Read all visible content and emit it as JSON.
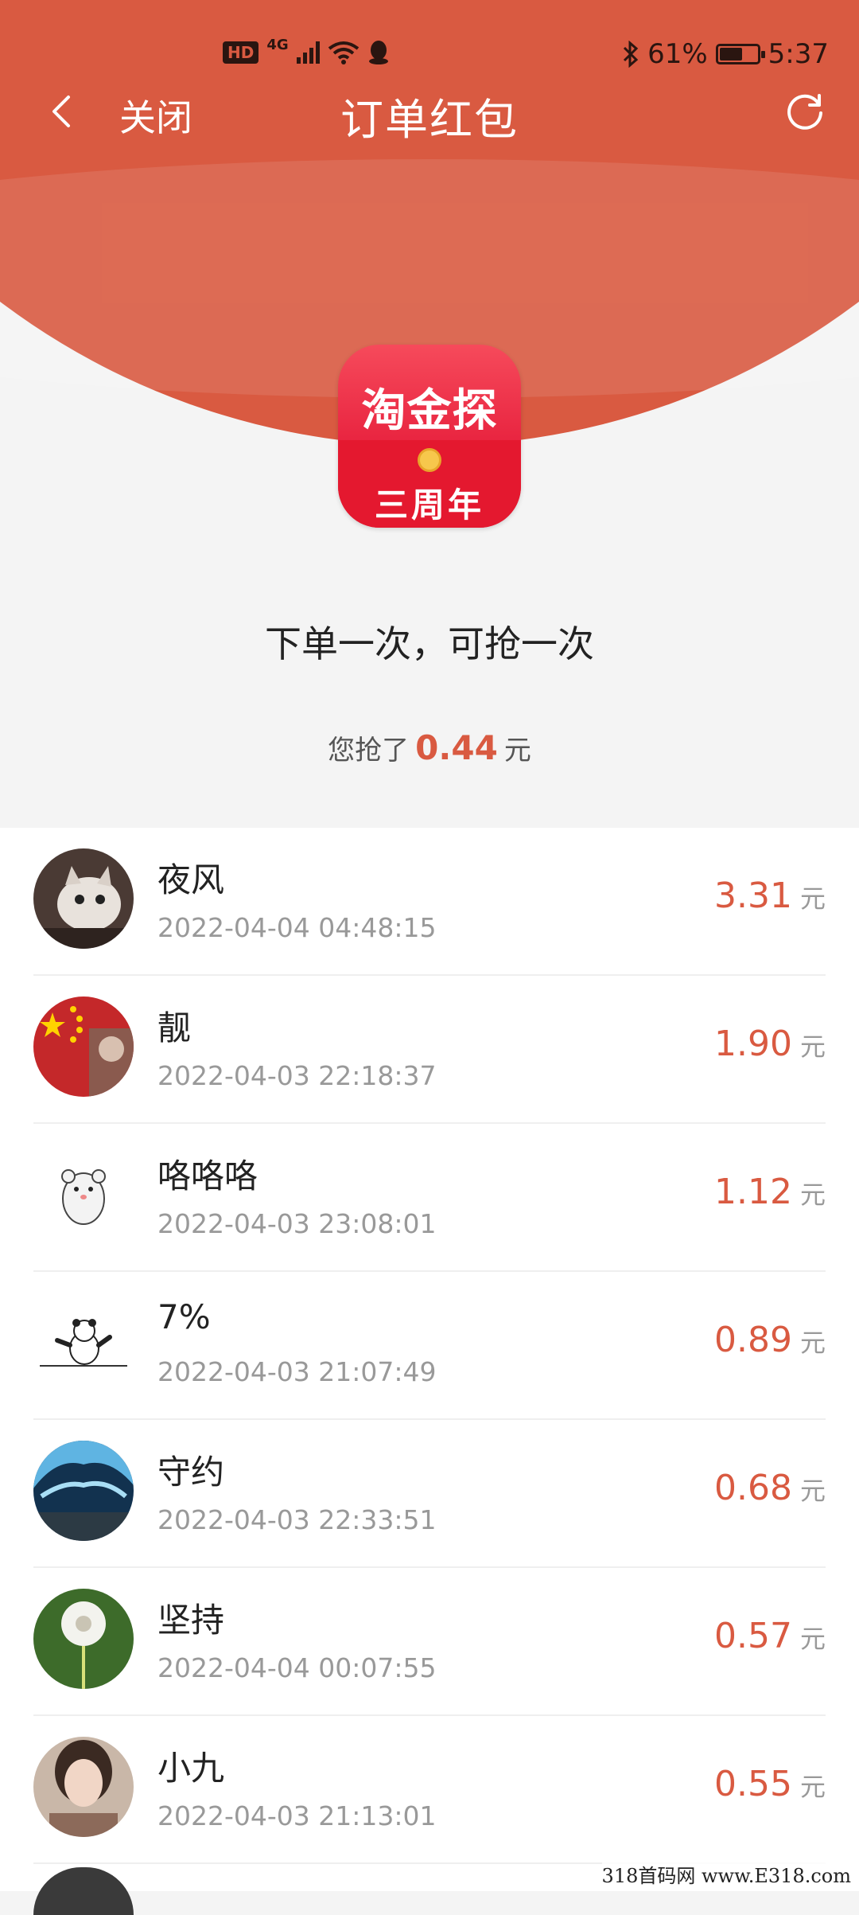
{
  "status_bar": {
    "hd": "HD",
    "network": "4G",
    "battery_percent": "61%",
    "battery_level": 0.61,
    "time": "5:37"
  },
  "nav": {
    "close_label": "关闭",
    "title": "订单红包"
  },
  "logo": {
    "top_text": "淘金探",
    "bottom_text": "三周年"
  },
  "rule_text": "下单一次，可抢一次",
  "grabbed": {
    "prefix": "您抢了",
    "amount": "0.44",
    "unit": "元"
  },
  "records": [
    {
      "name": "夜风",
      "time": "2022-04-04 04:48:15",
      "amount": "3.31",
      "unit": "元",
      "avatar": "cat-photo",
      "color": "#6b5a52"
    },
    {
      "name": "靓",
      "time": "2022-04-03 22:18:37",
      "amount": "1.90",
      "unit": "元",
      "avatar": "flag-photo",
      "color": "#c4282a"
    },
    {
      "name": "咯咯咯",
      "time": "2022-04-03 23:08:01",
      "amount": "1.12",
      "unit": "元",
      "avatar": "hamster-drawing",
      "color": "#ffffff"
    },
    {
      "name": "7%",
      "time": "2022-04-03 21:07:49",
      "amount": "0.89",
      "unit": "元",
      "avatar": "panda-drawing",
      "color": "#ffffff"
    },
    {
      "name": "守约",
      "time": "2022-04-03 22:33:51",
      "amount": "0.68",
      "unit": "元",
      "avatar": "ice-cave-photo",
      "color": "#2a6f9c"
    },
    {
      "name": "坚持",
      "time": "2022-04-04 00:07:55",
      "amount": "0.57",
      "unit": "元",
      "avatar": "dandelion-photo",
      "color": "#3f6a2b"
    },
    {
      "name": "小九",
      "time": "2022-04-03 21:13:01",
      "amount": "0.55",
      "unit": "元",
      "avatar": "girl-photo",
      "color": "#b58a74"
    }
  ],
  "watermark": "318首码网 www.E318.com"
}
